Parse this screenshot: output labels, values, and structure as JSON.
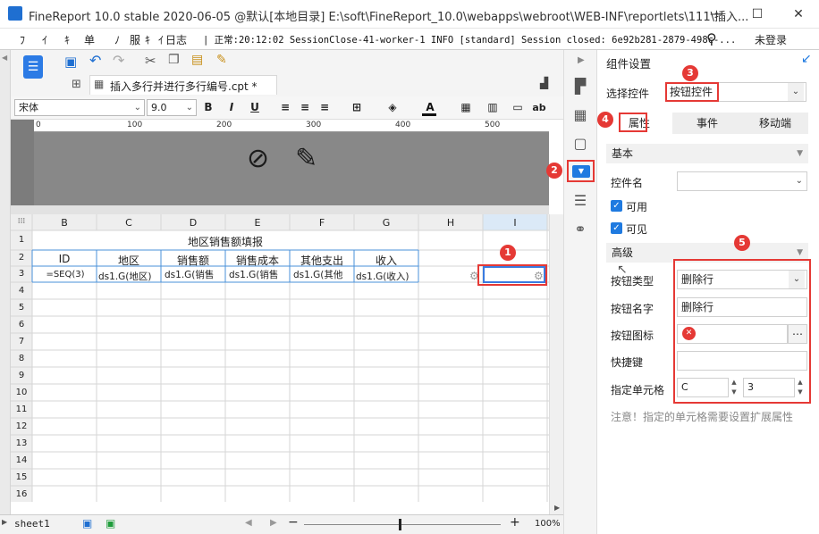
{
  "window": {
    "title": "FineReport 10.0 stable 2020-06-05 @默认[本地目录]     E:\\soft\\FineReport_10.0\\webapps\\webroot\\WEB-INF\\reportlets\\111\\插入..."
  },
  "menubar": {
    "items": [
      "ﾌ",
      "ｲ",
      "ｷ",
      "单",
      "ﾉ",
      "服",
      "ｷ",
      "ｲ"
    ],
    "log_label": "日志",
    "log_text": "| 正常:20:12:02 SessionClose-41-worker-1 INFO [standard] Session closed: 6e92b281-2879-498c-...",
    "login": "未登录"
  },
  "file_tab": {
    "label": "插入多行并进行多行编号.cpt *"
  },
  "format": {
    "font": "宋体",
    "size": "9.0",
    "bold": "B",
    "italic": "I",
    "underline": "U",
    "ab": "ab"
  },
  "ruler": {
    "ticks": [
      "0",
      "100",
      "200",
      "300",
      "400",
      "500"
    ]
  },
  "grid": {
    "columns": [
      "B",
      "C",
      "D",
      "E",
      "F",
      "G",
      "H",
      "I"
    ],
    "rows": [
      "1",
      "2",
      "3",
      "4",
      "5",
      "6",
      "7",
      "8",
      "9",
      "10",
      "11",
      "12",
      "13",
      "14",
      "15",
      "16"
    ],
    "title": "地区销售额填报",
    "headers": [
      "ID",
      "地区",
      "销售额",
      "销售成本",
      "其他支出",
      "收入"
    ],
    "row3": [
      "=SEQ(3)",
      "ds1.G(地区)",
      "ds1.G(销售",
      "ds1.G(销售",
      "ds1.G(其他",
      "ds1.G(收入)"
    ]
  },
  "sheet": {
    "tab": "sheet1",
    "zoom": "100%"
  },
  "panel": {
    "title": "组件设置",
    "choose_label": "选择控件",
    "choose_value": "按钮控件",
    "tabs": [
      "属性",
      "事件",
      "移动端"
    ],
    "basic": "基本",
    "name_label": "控件名",
    "enabled": "可用",
    "visible": "可见",
    "advanced": "高级",
    "btn_type_label": "按钮类型",
    "btn_type_value": "删除行",
    "btn_name_label": "按钮名字",
    "btn_name_value": "删除行",
    "btn_icon_label": "按钮图标",
    "hotkey_label": "快捷键",
    "cell_label": "指定单元格",
    "cell_col": "C",
    "cell_row": "3",
    "note": "注意！指定的单元格需要设置扩展属性"
  },
  "badges": [
    "1",
    "2",
    "3",
    "4",
    "5"
  ],
  "colors": {
    "accent": "#1f7ae0",
    "badge": "#e53935",
    "header_border": "#4a90d9"
  }
}
